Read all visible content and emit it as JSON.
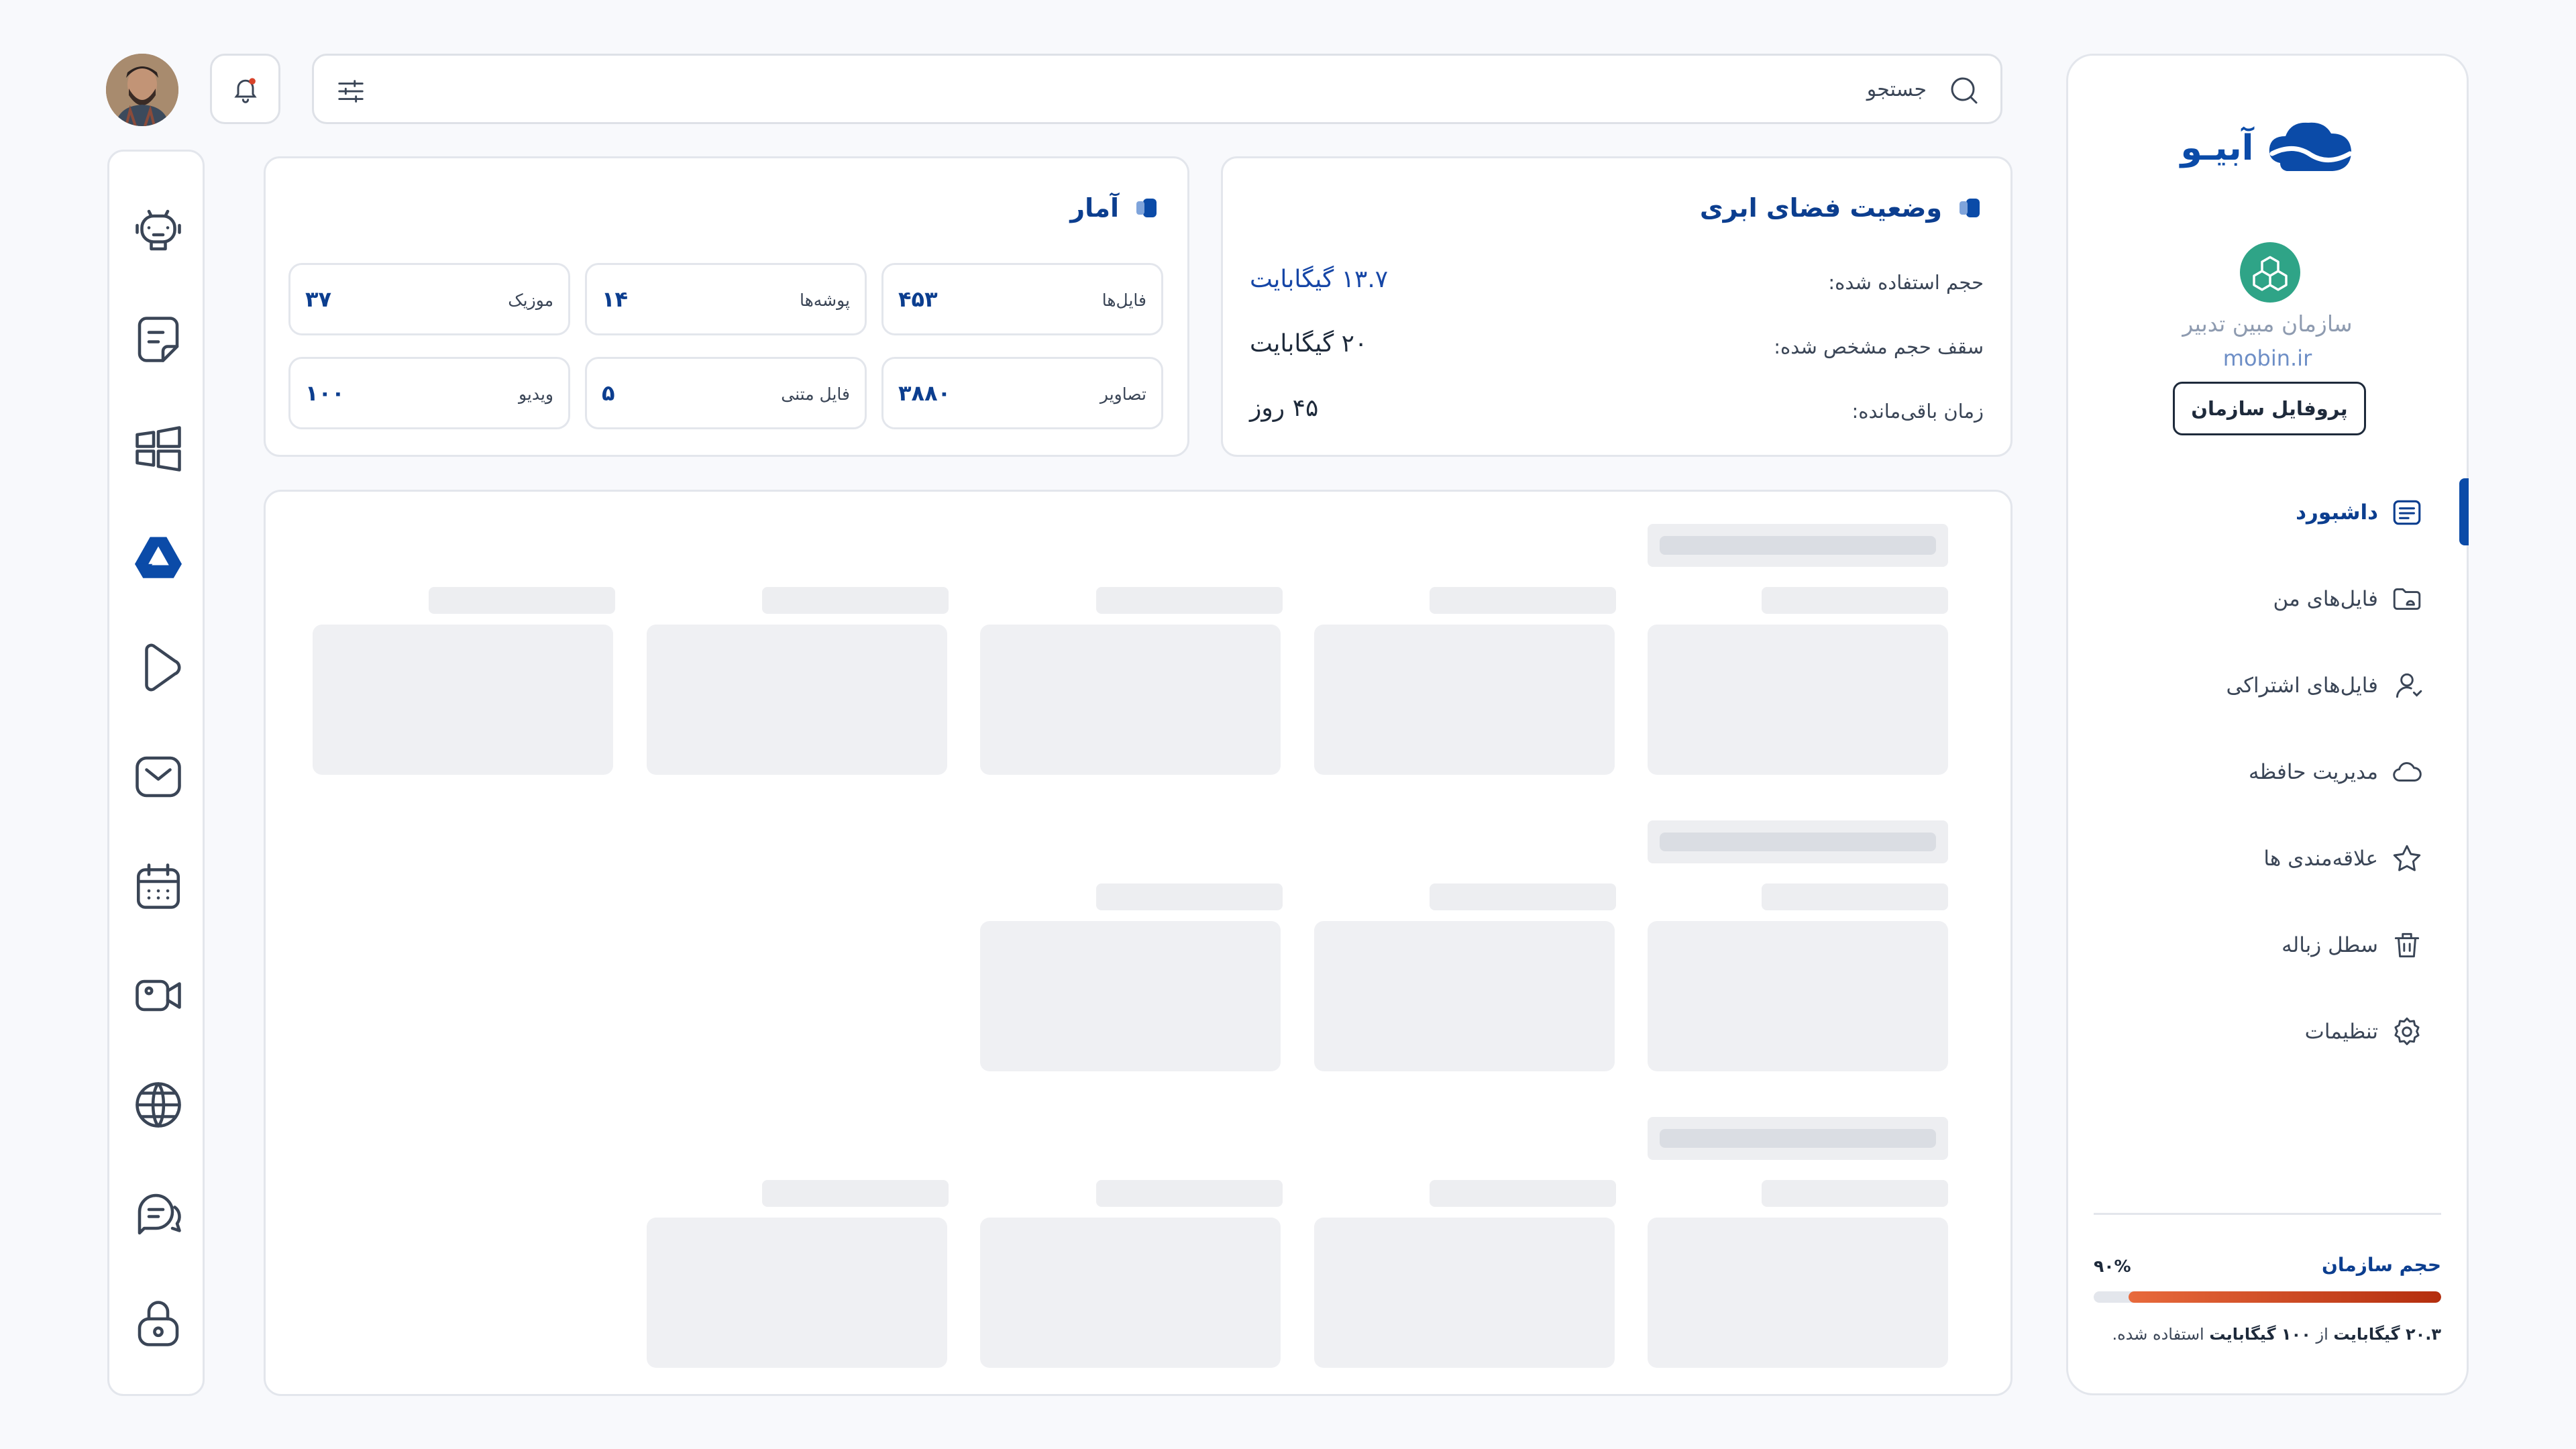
{
  "header": {
    "search_placeholder": "جستجو",
    "avatar_alt": "avatar"
  },
  "sidebar": {
    "logo_text": "آبیـو",
    "org_name": "سازمان مبین تدبیر",
    "org_domain": "mobin.ir",
    "profile_button": "پروفایل سازمان",
    "items": [
      {
        "label": "داشبورد",
        "icon": "dashboard-icon",
        "active": true
      },
      {
        "label": "فایل‌های من",
        "icon": "folder-icon",
        "active": false
      },
      {
        "label": "فایل‌های اشتراکی",
        "icon": "shared-user-icon",
        "active": false
      },
      {
        "label": "مدیریت حافظه",
        "icon": "cloud-icon",
        "active": false
      },
      {
        "label": "علاقه‌مندی ها",
        "icon": "star-icon",
        "active": false
      },
      {
        "label": "سطل زباله",
        "icon": "trash-icon",
        "active": false
      },
      {
        "label": "تنظیمات",
        "icon": "gear-icon",
        "active": false
      }
    ],
    "storage": {
      "title": "حجم سازمان",
      "percent_label": "۹۰%",
      "percent": 0.9,
      "used": "۲۰.۳ گیگابایت",
      "of_text": "از",
      "total": "۱۰۰ گیگابایت",
      "suffix": "استفاده شده."
    }
  },
  "rail": {
    "items": [
      "robot-icon",
      "note-icon",
      "windows-icon",
      "drive-icon",
      "play-icon",
      "mail-icon",
      "calendar-icon",
      "video-icon",
      "globe-icon",
      "chat-icon",
      "lock-icon"
    ]
  },
  "cloud_status": {
    "title": "وضعیت فضای ابری",
    "rows": [
      {
        "label": "حجم استفاده شده:",
        "value": "۱۳.۷ گیگابایت"
      },
      {
        "label": "سقف حجم مشخص شده:",
        "value": "۲۰ گیگابایت"
      },
      {
        "label": "زمان باقی‌مانده:",
        "value": "۴۵ روز"
      }
    ]
  },
  "stats": {
    "title": "آمار",
    "tiles": [
      {
        "label": "فایل‌ها",
        "value": "۴۵۳"
      },
      {
        "label": "پوشه‌ها",
        "value": "۱۴"
      },
      {
        "label": "موزیک",
        "value": "۳۷"
      },
      {
        "label": "تصاویر",
        "value": "۳۸۸۰"
      },
      {
        "label": "فایل متنی",
        "value": "۵"
      },
      {
        "label": "ویدیو",
        "value": "۱۰۰"
      }
    ]
  },
  "colors": {
    "brand": "#0B4BA8",
    "accent_dark": "#0C3E8F",
    "storage_bar": "#D4431A"
  }
}
